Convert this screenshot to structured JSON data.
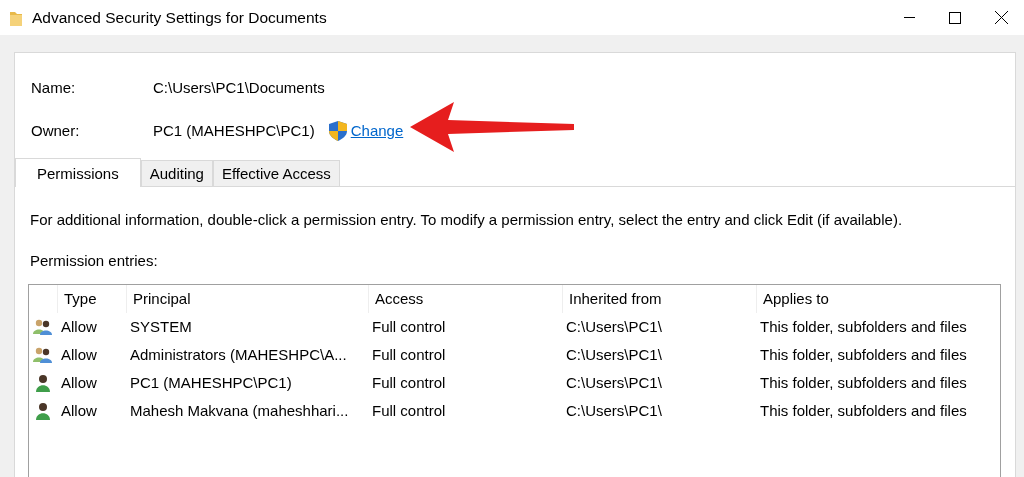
{
  "window": {
    "title": "Advanced Security Settings for Documents"
  },
  "name": {
    "label": "Name:",
    "value": "C:\\Users\\PC1\\Documents"
  },
  "owner": {
    "label": "Owner:",
    "value": "PC1 (MAHESHPC\\PC1)",
    "link": "Change"
  },
  "tabs": [
    {
      "label": "Permissions",
      "selected": true
    },
    {
      "label": "Auditing",
      "selected": false
    },
    {
      "label": "Effective Access",
      "selected": false
    }
  ],
  "info": "For additional information, double-click a permission entry. To modify a permission entry, select the entry and click Edit (if available).",
  "entries_label": "Permission entries:",
  "table": {
    "columns": [
      "Type",
      "Principal",
      "Access",
      "Inherited from",
      "Applies to"
    ],
    "rows": [
      {
        "kind": "group",
        "cells": [
          "Allow",
          "SYSTEM",
          "Full control",
          "C:\\Users\\PC1\\",
          "This folder, subfolders and files"
        ]
      },
      {
        "kind": "group",
        "cells": [
          "Allow",
          "Administrators (MAHESHPC\\A...",
          "Full control",
          "C:\\Users\\PC1\\",
          "This folder, subfolders and files"
        ]
      },
      {
        "kind": "user",
        "cells": [
          "Allow",
          "PC1 (MAHESHPC\\PC1)",
          "Full control",
          "C:\\Users\\PC1\\",
          "This folder, subfolders and files"
        ]
      },
      {
        "kind": "user",
        "cells": [
          "Allow",
          "Mahesh Makvana (maheshhari...",
          "Full control",
          "C:\\Users\\PC1\\",
          "This folder, subfolders and files"
        ]
      }
    ]
  }
}
